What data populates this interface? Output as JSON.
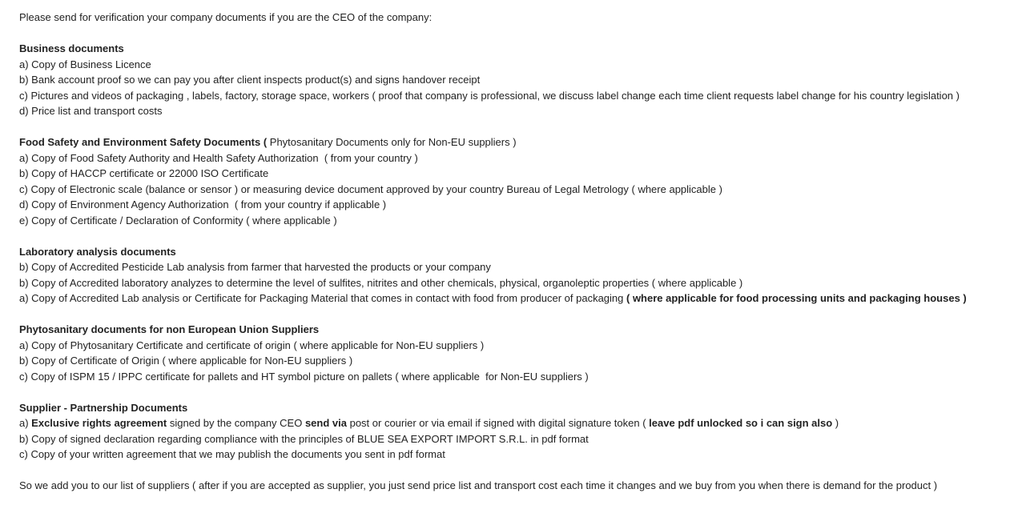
{
  "intro": [
    {
      "t": "Please send for verification your company documents if you are the CEO of the company:"
    }
  ],
  "sections": [
    {
      "lines": [
        [
          {
            "t": "Business documents",
            "b": true
          }
        ],
        [
          {
            "t": "a) Copy of Business Licence"
          }
        ],
        [
          {
            "t": "b) Bank account proof so we can pay you after client inspects product(s) and signs handover receipt"
          }
        ],
        [
          {
            "t": "c) Pictures and videos of packaging , labels, factory, storage space, workers ( proof that company is professional, we discuss label change each time client requests label change for his country legislation )"
          }
        ],
        [
          {
            "t": "d) Price list and transport costs"
          }
        ]
      ]
    },
    {
      "lines": [
        [
          {
            "t": "Food Safety and Environment Safety Documents (",
            "b": true
          },
          {
            "t": " Phytosanitary Documents only for Non-EU suppliers )"
          }
        ],
        [
          {
            "t": "a) Copy of Food Safety Authority and Health Safety Authorization  ( from your country )"
          }
        ],
        [
          {
            "t": "b) Copy of HACCP certificate or 22000 ISO Certificate"
          }
        ],
        [
          {
            "t": "c) Copy of Electronic scale (balance or sensor ) or measuring device document approved by your country Bureau of Legal Metrology ( where applicable )"
          }
        ],
        [
          {
            "t": "d) Copy of Environment Agency Authorization  ( from your country if applicable )"
          }
        ],
        [
          {
            "t": "e) Copy of Certificate / Declaration of Conformity ( where applicable )"
          }
        ]
      ]
    },
    {
      "lines": [
        [
          {
            "t": "Laboratory analysis documents",
            "b": true
          }
        ],
        [
          {
            "t": "b) Copy of Accredited Pesticide Lab analysis from farmer that harvested the products or your company"
          }
        ],
        [
          {
            "t": "b) Copy of Accredited laboratory analyzes to determine the level of sulfites, nitrites and other chemicals, physical, organoleptic properties ( where applicable )"
          }
        ],
        [
          {
            "t": "a) Copy of Accredited Lab analysis or Certificate for Packaging Material that comes in contact with food from producer of packaging "
          },
          {
            "t": "( where applicable for food processing units and packaging houses )",
            "b": true
          }
        ]
      ]
    },
    {
      "lines": [
        [
          {
            "t": "Phytosanitary documents for non European Union Suppliers",
            "b": true
          }
        ],
        [
          {
            "t": "a) Copy of Phytosanitary Certificate and certificate of origin ( where applicable for Non-EU suppliers )"
          }
        ],
        [
          {
            "t": "b) Copy of Certificate of Origin ( where applicable for Non-EU suppliers )"
          }
        ],
        [
          {
            "t": "c) Copy of ISPM 15 / IPPC certificate for pallets and HT symbol picture on pallets ( where applicable  for Non-EU suppliers )"
          }
        ]
      ]
    },
    {
      "lines": [
        [
          {
            "t": "Supplier - Partnership Documents",
            "b": true
          }
        ],
        [
          {
            "t": "a) "
          },
          {
            "t": "Exclusive rights agreement",
            "b": true
          },
          {
            "t": " signed by the company CEO "
          },
          {
            "t": "send via",
            "b": true
          },
          {
            "t": " post or courier or via email if signed with digital signature token ( "
          },
          {
            "t": "leave pdf unlocked so i can sign also",
            "b": true
          },
          {
            "t": " )"
          }
        ],
        [
          {
            "t": "b) Copy of signed declaration regarding compliance with the principles of BLUE SEA EXPORT IMPORT S.R.L. in pdf format"
          }
        ],
        [
          {
            "t": "c) Copy of your written agreement that we may publish the documents you sent in pdf format"
          }
        ]
      ]
    }
  ],
  "outro": [
    {
      "t": "So we add you to our list of suppliers ( after if you are accepted as supplier, you just send price list and transport cost each time it changes and we buy from you when there is demand for the product )"
    }
  ]
}
